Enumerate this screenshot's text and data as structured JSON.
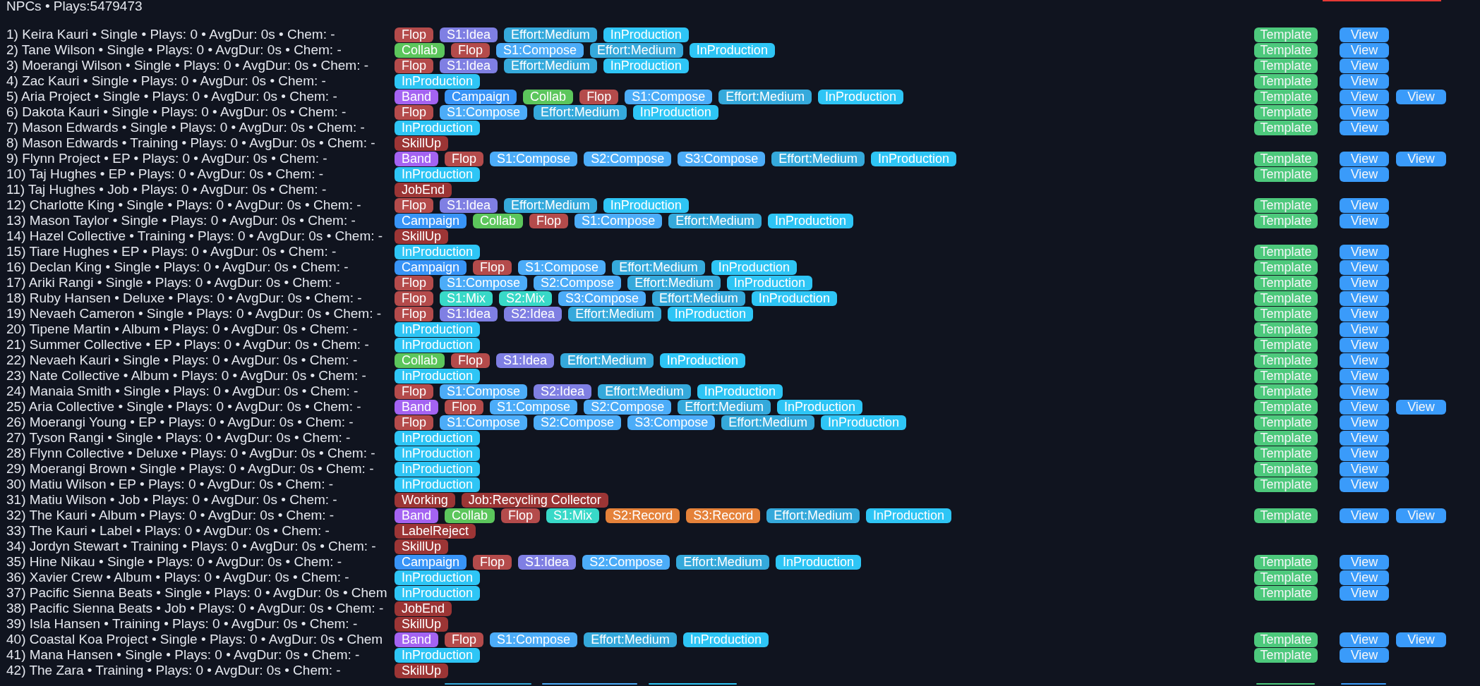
{
  "header": {
    "title": "NPCs • Plays:5479473"
  },
  "rows": [
    {
      "text": "1) Keira Kauri • Single • Plays: 0 • AvgDur: 0s • Chem: -",
      "tags": [
        {
          "label": "Flop",
          "color": "#b44b4b"
        },
        {
          "label": "S1:Idea",
          "color": "#7f7fe3"
        },
        {
          "label": "Effort:Medium",
          "color": "#35a9db"
        },
        {
          "label": "InProduction",
          "color": "#2ec5f5"
        }
      ],
      "actions": [
        {
          "label": "Template",
          "kind": "template"
        },
        {
          "label": "View",
          "kind": "view"
        }
      ]
    },
    {
      "text": "2) Tane Wilson • Single • Plays: 0 • AvgDur: 0s • Chem: -",
      "tags": [
        {
          "label": "Collab",
          "color": "#5cc65c"
        },
        {
          "label": "Flop",
          "color": "#b44b4b"
        },
        {
          "label": "S1:Compose",
          "color": "#4cacf8"
        },
        {
          "label": "Effort:Medium",
          "color": "#35a9db"
        },
        {
          "label": "InProduction",
          "color": "#2ec5f5"
        }
      ],
      "actions": [
        {
          "label": "Template",
          "kind": "template"
        },
        {
          "label": "View",
          "kind": "view"
        }
      ]
    },
    {
      "text": "3) Moerangi Wilson • Single • Plays: 0 • AvgDur: 0s • Chem: -",
      "tags": [
        {
          "label": "Flop",
          "color": "#b44b4b"
        },
        {
          "label": "S1:Idea",
          "color": "#7f7fe3"
        },
        {
          "label": "Effort:Medium",
          "color": "#35a9db"
        },
        {
          "label": "InProduction",
          "color": "#2ec5f5"
        }
      ],
      "actions": [
        {
          "label": "Template",
          "kind": "template"
        },
        {
          "label": "View",
          "kind": "view"
        }
      ]
    },
    {
      "text": "4) Zac Kauri • Single • Plays: 0 • AvgDur: 0s • Chem: -",
      "tags": [
        {
          "label": "InProduction",
          "color": "#2ec5f5"
        }
      ],
      "actions": [
        {
          "label": "Template",
          "kind": "template"
        },
        {
          "label": "View",
          "kind": "view"
        }
      ]
    },
    {
      "text": "5) Aria Project • Single • Plays: 0 • AvgDur: 0s • Chem: -",
      "tags": [
        {
          "label": "Band",
          "color": "#a463f2"
        },
        {
          "label": "Campaign",
          "color": "#3894f7"
        },
        {
          "label": "Collab",
          "color": "#5cc65c"
        },
        {
          "label": "Flop",
          "color": "#b44b4b"
        },
        {
          "label": "S1:Compose",
          "color": "#4cacf8"
        },
        {
          "label": "Effort:Medium",
          "color": "#35a9db"
        },
        {
          "label": "InProduction",
          "color": "#2ec5f5"
        }
      ],
      "actions": [
        {
          "label": "Template",
          "kind": "template"
        },
        {
          "label": "View",
          "kind": "view"
        },
        {
          "label": "View",
          "kind": "view"
        }
      ]
    },
    {
      "text": "6) Dakota Kauri • Single • Plays: 0 • AvgDur: 0s • Chem: -",
      "tags": [
        {
          "label": "Flop",
          "color": "#b44b4b"
        },
        {
          "label": "S1:Compose",
          "color": "#4cacf8"
        },
        {
          "label": "Effort:Medium",
          "color": "#35a9db"
        },
        {
          "label": "InProduction",
          "color": "#2ec5f5"
        }
      ],
      "actions": [
        {
          "label": "Template",
          "kind": "template"
        },
        {
          "label": "View",
          "kind": "view"
        }
      ]
    },
    {
      "text": "7) Mason Edwards • Single • Plays: 0 • AvgDur: 0s • Chem: -",
      "tags": [
        {
          "label": "InProduction",
          "color": "#2ec5f5"
        }
      ],
      "actions": [
        {
          "label": "Template",
          "kind": "template"
        },
        {
          "label": "View",
          "kind": "view"
        }
      ]
    },
    {
      "text": "8) Mason Edwards • Training • Plays: 0 • AvgDur: 0s • Chem: -",
      "tags": [
        {
          "label": "SkillUp",
          "color": "#9c3535"
        }
      ],
      "actions": []
    },
    {
      "text": "9) Flynn Project • EP • Plays: 0 • AvgDur: 0s • Chem: -",
      "tags": [
        {
          "label": "Band",
          "color": "#a463f2"
        },
        {
          "label": "Flop",
          "color": "#b44b4b"
        },
        {
          "label": "S1:Compose",
          "color": "#4cacf8"
        },
        {
          "label": "S2:Compose",
          "color": "#4cacf8"
        },
        {
          "label": "S3:Compose",
          "color": "#4cacf8"
        },
        {
          "label": "Effort:Medium",
          "color": "#35a9db"
        },
        {
          "label": "InProduction",
          "color": "#2ec5f5"
        }
      ],
      "actions": [
        {
          "label": "Template",
          "kind": "template"
        },
        {
          "label": "View",
          "kind": "view"
        },
        {
          "label": "View",
          "kind": "view"
        }
      ]
    },
    {
      "text": "10) Taj Hughes • EP • Plays: 0 • AvgDur: 0s • Chem: -",
      "tags": [
        {
          "label": "InProduction",
          "color": "#2ec5f5"
        }
      ],
      "actions": [
        {
          "label": "Template",
          "kind": "template"
        },
        {
          "label": "View",
          "kind": "view"
        }
      ]
    },
    {
      "text": "11) Taj Hughes • Job • Plays: 0 • AvgDur: 0s • Chem: -",
      "tags": [
        {
          "label": "JobEnd",
          "color": "#9c3535"
        }
      ],
      "actions": []
    },
    {
      "text": "12) Charlotte King • Single • Plays: 0 • AvgDur: 0s • Chem: -",
      "tags": [
        {
          "label": "Flop",
          "color": "#b44b4b"
        },
        {
          "label": "S1:Idea",
          "color": "#7f7fe3"
        },
        {
          "label": "Effort:Medium",
          "color": "#35a9db"
        },
        {
          "label": "InProduction",
          "color": "#2ec5f5"
        }
      ],
      "actions": [
        {
          "label": "Template",
          "kind": "template"
        },
        {
          "label": "View",
          "kind": "view"
        }
      ]
    },
    {
      "text": "13) Mason Taylor • Single • Plays: 0 • AvgDur: 0s • Chem: -",
      "tags": [
        {
          "label": "Campaign",
          "color": "#3894f7"
        },
        {
          "label": "Collab",
          "color": "#5cc65c"
        },
        {
          "label": "Flop",
          "color": "#b44b4b"
        },
        {
          "label": "S1:Compose",
          "color": "#4cacf8"
        },
        {
          "label": "Effort:Medium",
          "color": "#35a9db"
        },
        {
          "label": "InProduction",
          "color": "#2ec5f5"
        }
      ],
      "actions": [
        {
          "label": "Template",
          "kind": "template"
        },
        {
          "label": "View",
          "kind": "view"
        }
      ]
    },
    {
      "text": "14) Hazel Collective • Training • Plays: 0 • AvgDur: 0s • Chem: -",
      "tags": [
        {
          "label": "SkillUp",
          "color": "#9c3535"
        }
      ],
      "actions": []
    },
    {
      "text": "15) Tiare Hughes • EP • Plays: 0 • AvgDur: 0s • Chem: -",
      "tags": [
        {
          "label": "InProduction",
          "color": "#2ec5f5"
        }
      ],
      "actions": [
        {
          "label": "Template",
          "kind": "template"
        },
        {
          "label": "View",
          "kind": "view"
        }
      ]
    },
    {
      "text": "16) Declan King • Single • Plays: 0 • AvgDur: 0s • Chem: -",
      "tags": [
        {
          "label": "Campaign",
          "color": "#3894f7"
        },
        {
          "label": "Flop",
          "color": "#b44b4b"
        },
        {
          "label": "S1:Compose",
          "color": "#4cacf8"
        },
        {
          "label": "Effort:Medium",
          "color": "#35a9db"
        },
        {
          "label": "InProduction",
          "color": "#2ec5f5"
        }
      ],
      "actions": [
        {
          "label": "Template",
          "kind": "template"
        },
        {
          "label": "View",
          "kind": "view"
        }
      ]
    },
    {
      "text": "17) Ariki Rangi • Single • Plays: 0 • AvgDur: 0s • Chem: -",
      "tags": [
        {
          "label": "Flop",
          "color": "#b44b4b"
        },
        {
          "label": "S1:Compose",
          "color": "#4cacf8"
        },
        {
          "label": "S2:Compose",
          "color": "#4cacf8"
        },
        {
          "label": "Effort:Medium",
          "color": "#35a9db"
        },
        {
          "label": "InProduction",
          "color": "#2ec5f5"
        }
      ],
      "actions": [
        {
          "label": "Template",
          "kind": "template"
        },
        {
          "label": "View",
          "kind": "view"
        }
      ]
    },
    {
      "text": "18) Ruby Hansen • Deluxe • Plays: 0 • AvgDur: 0s • Chem: -",
      "tags": [
        {
          "label": "Flop",
          "color": "#b44b4b"
        },
        {
          "label": "S1:Mix",
          "color": "#38d9c8"
        },
        {
          "label": "S2:Mix",
          "color": "#38d9c8"
        },
        {
          "label": "S3:Compose",
          "color": "#4cacf8"
        },
        {
          "label": "Effort:Medium",
          "color": "#35a9db"
        },
        {
          "label": "InProduction",
          "color": "#2ec5f5"
        }
      ],
      "actions": [
        {
          "label": "Template",
          "kind": "template"
        },
        {
          "label": "View",
          "kind": "view"
        }
      ]
    },
    {
      "text": "19) Nevaeh Cameron • Single • Plays: 0 • AvgDur: 0s • Chem: -",
      "tags": [
        {
          "label": "Flop",
          "color": "#b44b4b"
        },
        {
          "label": "S1:Idea",
          "color": "#7f7fe3"
        },
        {
          "label": "S2:Idea",
          "color": "#7f7fe3"
        },
        {
          "label": "Effort:Medium",
          "color": "#35a9db"
        },
        {
          "label": "InProduction",
          "color": "#2ec5f5"
        }
      ],
      "actions": [
        {
          "label": "Template",
          "kind": "template"
        },
        {
          "label": "View",
          "kind": "view"
        }
      ]
    },
    {
      "text": "20) Tipene Martin • Album • Plays: 0 • AvgDur: 0s • Chem: -",
      "tags": [
        {
          "label": "InProduction",
          "color": "#2ec5f5"
        }
      ],
      "actions": [
        {
          "label": "Template",
          "kind": "template"
        },
        {
          "label": "View",
          "kind": "view"
        }
      ]
    },
    {
      "text": "21) Summer Collective • EP • Plays: 0 • AvgDur: 0s • Chem: -",
      "tags": [
        {
          "label": "InProduction",
          "color": "#2ec5f5"
        }
      ],
      "actions": [
        {
          "label": "Template",
          "kind": "template"
        },
        {
          "label": "View",
          "kind": "view"
        }
      ]
    },
    {
      "text": "22) Nevaeh Kauri • Single • Plays: 0 • AvgDur: 0s • Chem: -",
      "tags": [
        {
          "label": "Collab",
          "color": "#5cc65c"
        },
        {
          "label": "Flop",
          "color": "#b44b4b"
        },
        {
          "label": "S1:Idea",
          "color": "#7f7fe3"
        },
        {
          "label": "Effort:Medium",
          "color": "#35a9db"
        },
        {
          "label": "InProduction",
          "color": "#2ec5f5"
        }
      ],
      "actions": [
        {
          "label": "Template",
          "kind": "template"
        },
        {
          "label": "View",
          "kind": "view"
        }
      ]
    },
    {
      "text": "23) Nate Collective • Album • Plays: 0 • AvgDur: 0s • Chem: -",
      "tags": [
        {
          "label": "InProduction",
          "color": "#2ec5f5"
        }
      ],
      "actions": [
        {
          "label": "Template",
          "kind": "template"
        },
        {
          "label": "View",
          "kind": "view"
        }
      ]
    },
    {
      "text": "24) Manaia Smith • Single • Plays: 0 • AvgDur: 0s • Chem: -",
      "tags": [
        {
          "label": "Flop",
          "color": "#b44b4b"
        },
        {
          "label": "S1:Compose",
          "color": "#4cacf8"
        },
        {
          "label": "S2:Idea",
          "color": "#7f7fe3"
        },
        {
          "label": "Effort:Medium",
          "color": "#35a9db"
        },
        {
          "label": "InProduction",
          "color": "#2ec5f5"
        }
      ],
      "actions": [
        {
          "label": "Template",
          "kind": "template"
        },
        {
          "label": "View",
          "kind": "view"
        }
      ]
    },
    {
      "text": "25) Aria Collective • Single • Plays: 0 • AvgDur: 0s • Chem: -",
      "tags": [
        {
          "label": "Band",
          "color": "#a463f2"
        },
        {
          "label": "Flop",
          "color": "#b44b4b"
        },
        {
          "label": "S1:Compose",
          "color": "#4cacf8"
        },
        {
          "label": "S2:Compose",
          "color": "#4cacf8"
        },
        {
          "label": "Effort:Medium",
          "color": "#35a9db"
        },
        {
          "label": "InProduction",
          "color": "#2ec5f5"
        }
      ],
      "actions": [
        {
          "label": "Template",
          "kind": "template"
        },
        {
          "label": "View",
          "kind": "view"
        },
        {
          "label": "View",
          "kind": "view"
        }
      ]
    },
    {
      "text": "26) Moerangi Young • EP • Plays: 0 • AvgDur: 0s • Chem: -",
      "tags": [
        {
          "label": "Flop",
          "color": "#b44b4b"
        },
        {
          "label": "S1:Compose",
          "color": "#4cacf8"
        },
        {
          "label": "S2:Compose",
          "color": "#4cacf8"
        },
        {
          "label": "S3:Compose",
          "color": "#4cacf8"
        },
        {
          "label": "Effort:Medium",
          "color": "#35a9db"
        },
        {
          "label": "InProduction",
          "color": "#2ec5f5"
        }
      ],
      "actions": [
        {
          "label": "Template",
          "kind": "template"
        },
        {
          "label": "View",
          "kind": "view"
        }
      ]
    },
    {
      "text": "27) Tyson Rangi • Single • Plays: 0 • AvgDur: 0s • Chem: -",
      "tags": [
        {
          "label": "InProduction",
          "color": "#2ec5f5"
        }
      ],
      "actions": [
        {
          "label": "Template",
          "kind": "template"
        },
        {
          "label": "View",
          "kind": "view"
        }
      ]
    },
    {
      "text": "28) Flynn Collective • Deluxe • Plays: 0 • AvgDur: 0s • Chem: -",
      "tags": [
        {
          "label": "InProduction",
          "color": "#2ec5f5"
        }
      ],
      "actions": [
        {
          "label": "Template",
          "kind": "template"
        },
        {
          "label": "View",
          "kind": "view"
        }
      ]
    },
    {
      "text": "29) Moerangi Brown • Single • Plays: 0 • AvgDur: 0s • Chem: -",
      "tags": [
        {
          "label": "InProduction",
          "color": "#2ec5f5"
        }
      ],
      "actions": [
        {
          "label": "Template",
          "kind": "template"
        },
        {
          "label": "View",
          "kind": "view"
        }
      ]
    },
    {
      "text": "30) Matiu Wilson • EP • Plays: 0 • AvgDur: 0s • Chem: -",
      "tags": [
        {
          "label": "InProduction",
          "color": "#2ec5f5"
        }
      ],
      "actions": [
        {
          "label": "Template",
          "kind": "template"
        },
        {
          "label": "View",
          "kind": "view"
        }
      ]
    },
    {
      "text": "31) Matiu Wilson • Job • Plays: 0 • AvgDur: 0s • Chem: -",
      "tags": [
        {
          "label": "Working",
          "color": "#9c3535"
        },
        {
          "label": "Job:Recycling Collector",
          "color": "#9c3535"
        }
      ],
      "actions": []
    },
    {
      "text": "32) The Kauri • Album • Plays: 0 • AvgDur: 0s • Chem: -",
      "tags": [
        {
          "label": "Band",
          "color": "#a463f2"
        },
        {
          "label": "Collab",
          "color": "#5cc65c"
        },
        {
          "label": "Flop",
          "color": "#b44b4b"
        },
        {
          "label": "S1:Mix",
          "color": "#38d9c8"
        },
        {
          "label": "S2:Record",
          "color": "#e5823a"
        },
        {
          "label": "S3:Record",
          "color": "#e5823a"
        },
        {
          "label": "Effort:Medium",
          "color": "#35a9db"
        },
        {
          "label": "InProduction",
          "color": "#2ec5f5"
        }
      ],
      "actions": [
        {
          "label": "Template",
          "kind": "template"
        },
        {
          "label": "View",
          "kind": "view"
        },
        {
          "label": "View",
          "kind": "view"
        }
      ]
    },
    {
      "text": "33) The Kauri • Label • Plays: 0 • AvgDur: 0s • Chem: -",
      "tags": [
        {
          "label": "LabelReject",
          "color": "#9c3535"
        }
      ],
      "actions": []
    },
    {
      "text": "34) Jordyn Stewart • Training • Plays: 0 • AvgDur: 0s • Chem: -",
      "tags": [
        {
          "label": "SkillUp",
          "color": "#9c3535"
        }
      ],
      "actions": []
    },
    {
      "text": "35) Hine Nikau • Single • Plays: 0 • AvgDur: 0s • Chem: -",
      "tags": [
        {
          "label": "Campaign",
          "color": "#3894f7"
        },
        {
          "label": "Flop",
          "color": "#b44b4b"
        },
        {
          "label": "S1:Idea",
          "color": "#7f7fe3"
        },
        {
          "label": "S2:Compose",
          "color": "#4cacf8"
        },
        {
          "label": "Effort:Medium",
          "color": "#35a9db"
        },
        {
          "label": "InProduction",
          "color": "#2ec5f5"
        }
      ],
      "actions": [
        {
          "label": "Template",
          "kind": "template"
        },
        {
          "label": "View",
          "kind": "view"
        }
      ]
    },
    {
      "text": "36) Xavier Crew • Album • Plays: 0 • AvgDur: 0s • Chem: -",
      "tags": [
        {
          "label": "InProduction",
          "color": "#2ec5f5"
        }
      ],
      "actions": [
        {
          "label": "Template",
          "kind": "template"
        },
        {
          "label": "View",
          "kind": "view"
        }
      ]
    },
    {
      "text": "37) Pacific Sienna Beats • Single • Plays: 0 • AvgDur: 0s • Chem",
      "tags": [
        {
          "label": "InProduction",
          "color": "#2ec5f5"
        }
      ],
      "actions": [
        {
          "label": "Template",
          "kind": "template"
        },
        {
          "label": "View",
          "kind": "view"
        }
      ]
    },
    {
      "text": "38) Pacific Sienna Beats • Job • Plays: 0 • AvgDur: 0s • Chem: -",
      "tags": [
        {
          "label": "JobEnd",
          "color": "#9c3535"
        }
      ],
      "actions": []
    },
    {
      "text": "39) Isla Hansen • Training • Plays: 0 • AvgDur: 0s • Chem: -",
      "tags": [
        {
          "label": "SkillUp",
          "color": "#9c3535"
        }
      ],
      "actions": []
    },
    {
      "text": "40) Coastal Koa Project • Single • Plays: 0 • AvgDur: 0s • Chem",
      "tags": [
        {
          "label": "Band",
          "color": "#a463f2"
        },
        {
          "label": "Flop",
          "color": "#b44b4b"
        },
        {
          "label": "S1:Compose",
          "color": "#4cacf8"
        },
        {
          "label": "Effort:Medium",
          "color": "#35a9db"
        },
        {
          "label": "InProduction",
          "color": "#2ec5f5"
        }
      ],
      "actions": [
        {
          "label": "Template",
          "kind": "template"
        },
        {
          "label": "View",
          "kind": "view"
        },
        {
          "label": "View",
          "kind": "view"
        }
      ]
    },
    {
      "text": "41) Mana Hansen • Single • Plays: 0 • AvgDur: 0s • Chem: -",
      "tags": [
        {
          "label": "InProduction",
          "color": "#2ec5f5"
        }
      ],
      "actions": [
        {
          "label": "Template",
          "kind": "template"
        },
        {
          "label": "View",
          "kind": "view"
        }
      ]
    },
    {
      "text": "42) The Zara • Training • Plays: 0 • AvgDur: 0s • Chem: -",
      "tags": [
        {
          "label": "SkillUp",
          "color": "#9c3535"
        }
      ],
      "actions": []
    }
  ]
}
